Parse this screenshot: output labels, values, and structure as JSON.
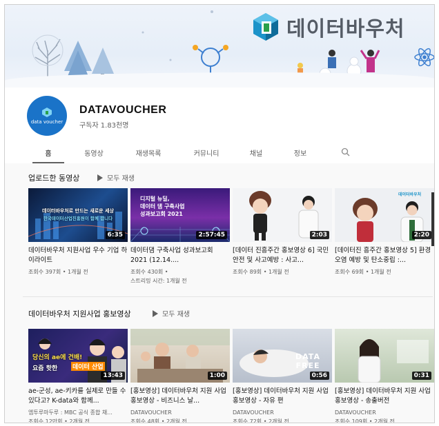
{
  "brand": {
    "name": "데이터바우처"
  },
  "channel": {
    "name": "DATAVOUCHER",
    "subscribers": "구독자 1.83천명",
    "avatar_text": "data voucher"
  },
  "tabs": [
    {
      "label": "홈"
    },
    {
      "label": "동영상"
    },
    {
      "label": "재생목록"
    },
    {
      "label": "커뮤니티"
    },
    {
      "label": "채널"
    },
    {
      "label": "정보"
    }
  ],
  "search_icon": "search-icon",
  "section1": {
    "title": "업로드한 동영상",
    "play_all": "모두 재생",
    "videos": [
      {
        "title": "데이터바우처 지원사업 우수 기업 하이라이트",
        "meta1": "조회수 397회 • 1개월 전",
        "meta2": "",
        "duration": "6:35",
        "overlay1": "데이터바우처로 만드는 새로운 세상",
        "overlay2": "한국데이터산업진흥원이 함께 합니다"
      },
      {
        "title": "데이터댐 구축사업 성과보고회 2021 (12.14....",
        "meta1": "조회수 430회 •",
        "meta2": "스트리밍 시간: 1개월 전",
        "duration": "2:57:45",
        "overlay1": "디지털 뉴딜,",
        "overlay2": "데이터 댐 구축사업",
        "overlay3": "성과보고회 2021"
      },
      {
        "title": "[데이터 진흥주간 홍보영상 6] 국민안전 및 사고예방 : 사고...",
        "meta1": "조회수 89회 • 1개월 전",
        "meta2": "",
        "duration": "2:03"
      },
      {
        "title": "[데이터진 흥주간 홍보영상 5] 환경오염 예방 및 탄소중립 :...",
        "meta1": "조회수 69회 • 1개월 전",
        "meta2": "",
        "duration": "2:20",
        "overlay1": "데이터바우처"
      }
    ]
  },
  "section2": {
    "title": "데이터바우처 지원사업 홍보영상",
    "play_all": "모두 재생",
    "videos": [
      {
        "title": "ae-군성, ae-키카를 실제로 만들 수 있다고? K-data와 함께...",
        "meta1": "엠투루마두루 : MBC 공식 종합 채...",
        "meta2": "조회수 12만회 • 2개월 전",
        "duration": "13:43",
        "overlay1": "당신의 ae에 건배!",
        "overlay2": "요즘 핫한",
        "overlay3": "데이터 산업"
      },
      {
        "title": "[홍보영상] 데이터바우처 지원 사업 홍보영상 - 비즈니스 날...",
        "meta1": "DATAVOUCHER",
        "meta2": "조회수 48회 • 2개월 전",
        "duration": "1:00"
      },
      {
        "title": "[홍보영상] 데이터바우처 지원 사업 홍보영상 - 자유 편",
        "meta1": "DATAVOUCHER",
        "meta2": "조회수 72회 • 2개월 전",
        "duration": "0:56",
        "overlay1": "DATA FREE"
      },
      {
        "title": "[홍보영상] 데이터바우처 지원 사업 홍보영상 - 송출버전",
        "meta1": "DATAVOUCHER",
        "meta2": "조회수 109회 • 2개월 전",
        "duration": "0:31"
      }
    ]
  }
}
